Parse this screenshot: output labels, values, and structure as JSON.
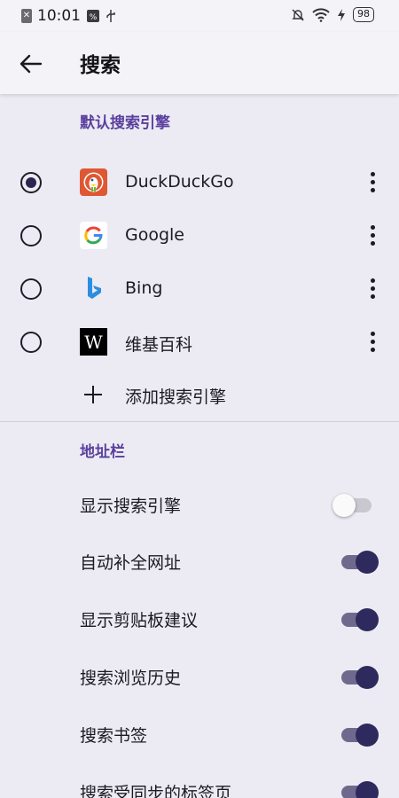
{
  "status_bar": {
    "time": "10:01",
    "battery": "98"
  },
  "header": {
    "title": "搜索"
  },
  "default_engines": {
    "section_title": "默认搜索引擎",
    "engines": [
      {
        "name": "DuckDuckGo",
        "selected": true,
        "logo": "duckduckgo-logo"
      },
      {
        "name": "Google",
        "selected": false,
        "logo": "google-logo"
      },
      {
        "name": "Bing",
        "selected": false,
        "logo": "bing-logo"
      },
      {
        "name": "维基百科",
        "selected": false,
        "logo": "wikipedia-logo"
      }
    ],
    "add_label": "添加搜索引擎"
  },
  "address_bar": {
    "section_title": "地址栏",
    "toggles": [
      {
        "label": "显示搜索引擎",
        "on": false
      },
      {
        "label": "自动补全网址",
        "on": true
      },
      {
        "label": "显示剪贴板建议",
        "on": true
      },
      {
        "label": "搜索浏览历史",
        "on": true
      },
      {
        "label": "搜索书签",
        "on": true
      },
      {
        "label": "搜索受同步的标签页",
        "on": true
      }
    ]
  },
  "colors": {
    "accent": "#5a3f9e",
    "switch_on": "#2e2a5e",
    "background": "#ecebf3"
  }
}
